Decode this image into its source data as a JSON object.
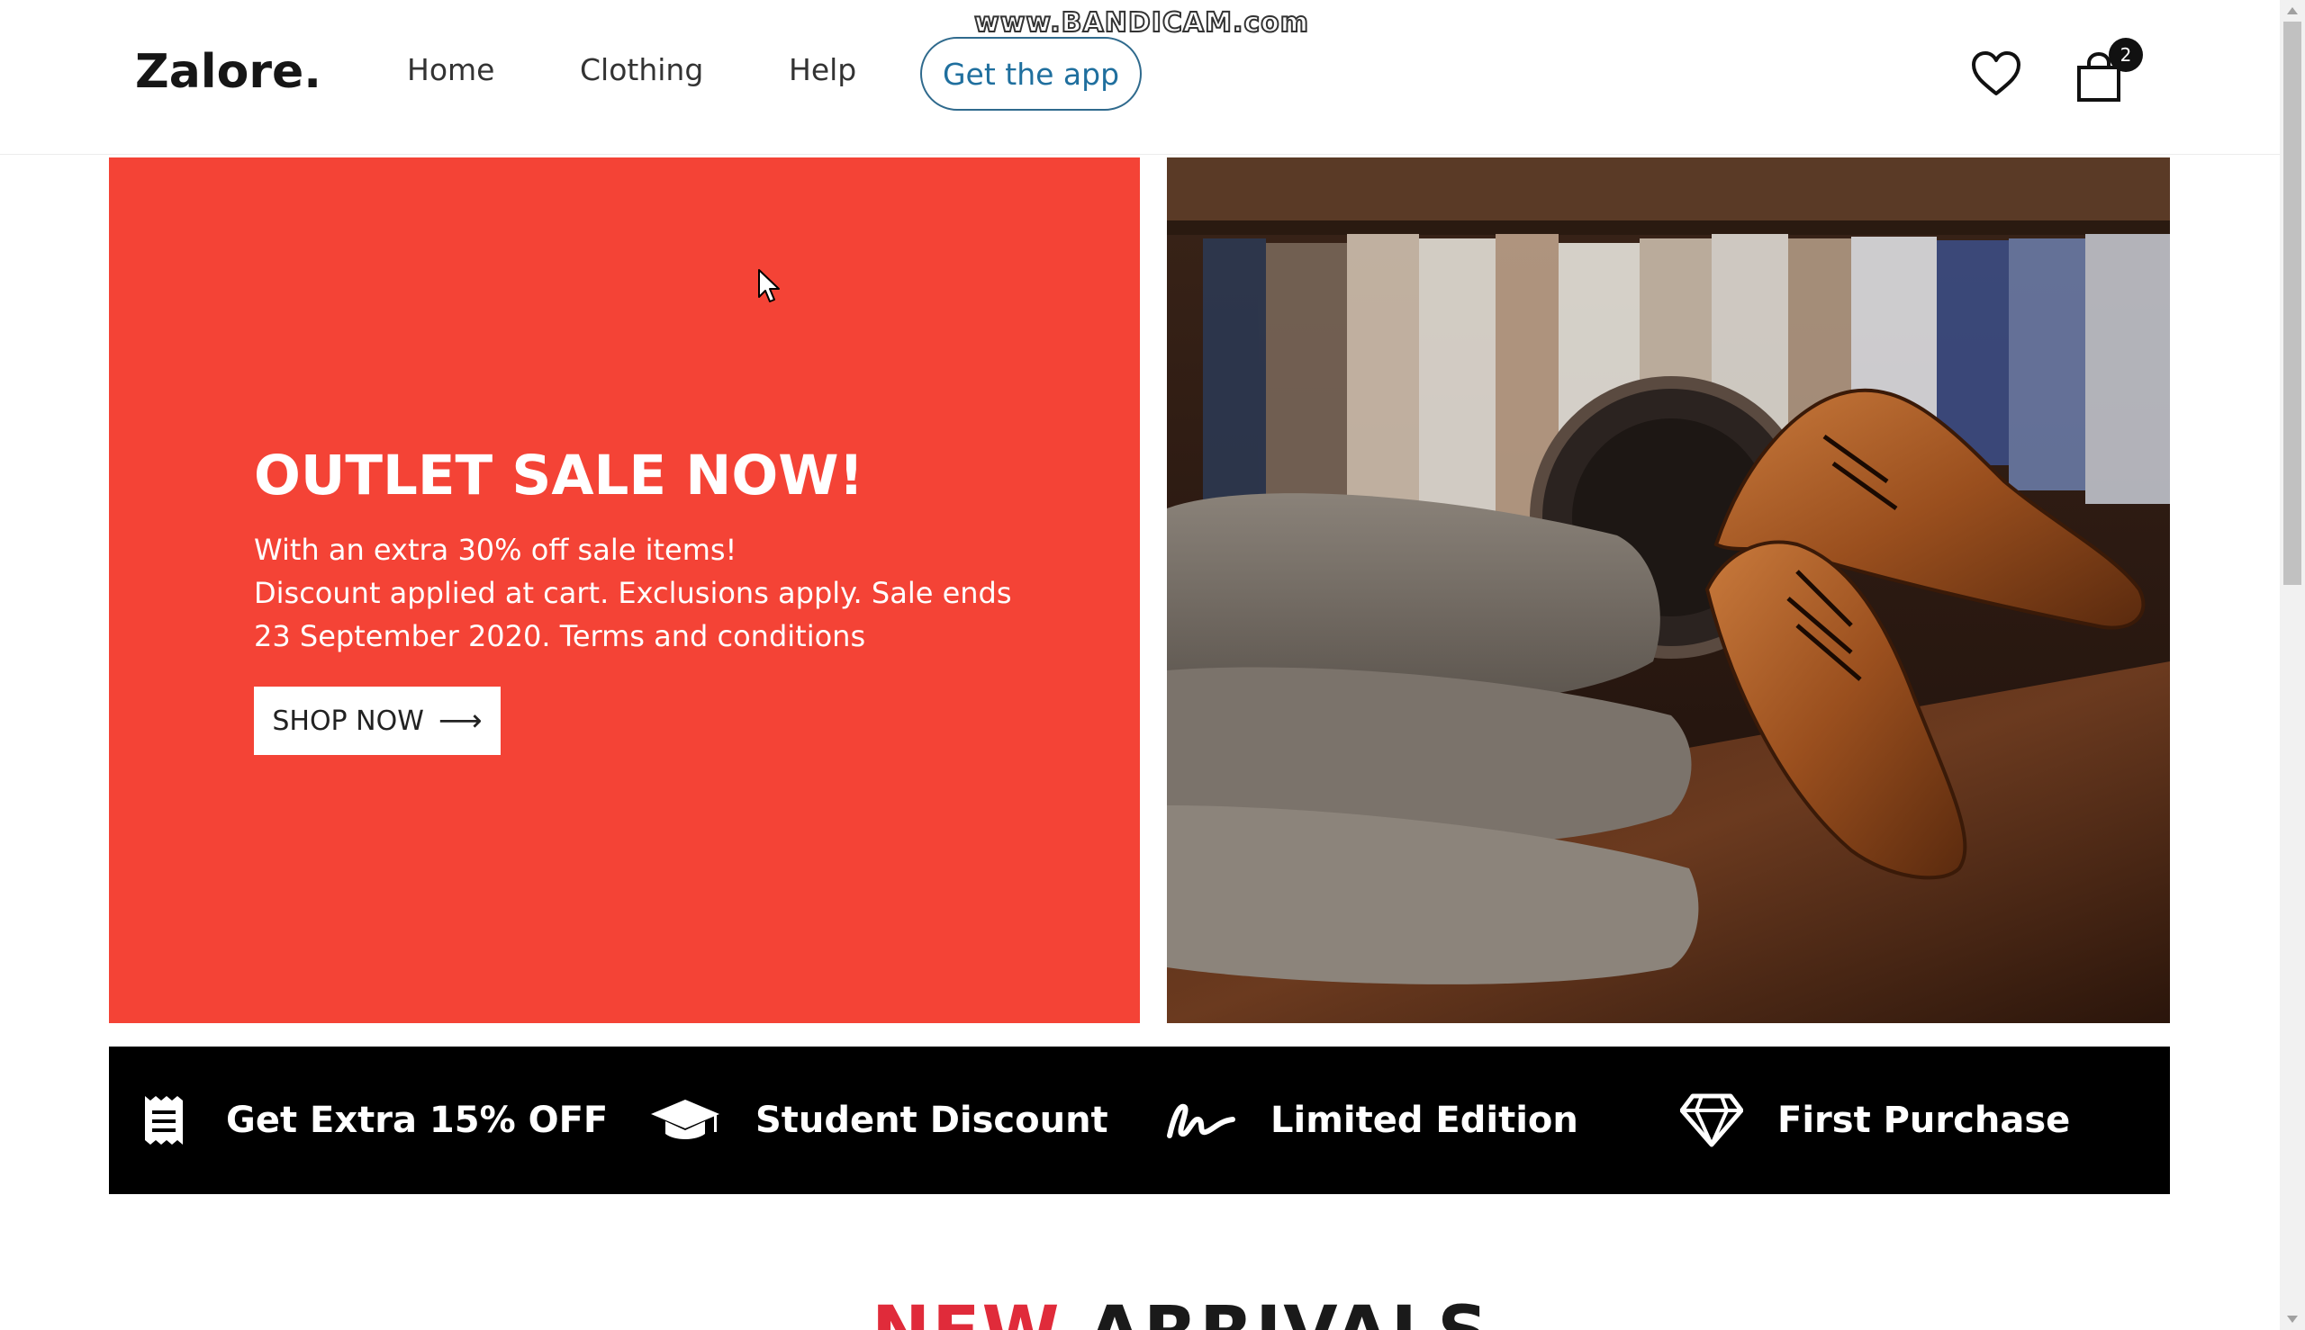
{
  "watermark": "www.BANDICAM.com",
  "header": {
    "logo": "Zalore.",
    "nav": {
      "home": "Home",
      "clothing": "Clothing",
      "help": "Help"
    },
    "app_button": "Get the app",
    "cart_count": "2",
    "icons": {
      "wishlist": "heart-icon",
      "cart": "shopping-bag-icon"
    }
  },
  "hero": {
    "title": "OUTLET SALE NOW!",
    "line1": "With an extra 30% off sale items!",
    "line2": "Discount applied at cart. Exclusions apply. Sale ends",
    "line3": "23 September 2020. Terms and conditions",
    "cta_label": "SHOP NOW",
    "cta_arrow": "⟶",
    "background_color": "#f44336"
  },
  "perks": [
    {
      "label": "Get Extra 15% OFF",
      "icon": "receipt-icon"
    },
    {
      "label": "Student Discount",
      "icon": "graduation-cap-icon"
    },
    {
      "label": "Limited Edition",
      "icon": "signature-icon"
    },
    {
      "label": "First Purchase",
      "icon": "diamond-icon"
    }
  ],
  "arrivals": {
    "accent": "NEW",
    "rest": "ARRIVALS",
    "accent_color": "#e02b3a"
  },
  "colors": {
    "accent_blue": "#1f6f9e",
    "perks_bg": "#000000"
  }
}
